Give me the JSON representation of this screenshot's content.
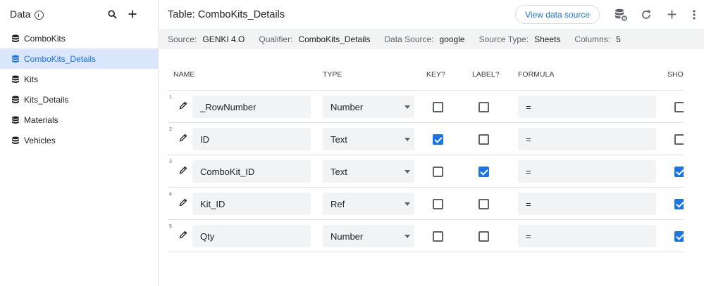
{
  "sidebar": {
    "title": "Data",
    "items": [
      {
        "label": "ComboKits",
        "active": false
      },
      {
        "label": "ComboKits_Details",
        "active": true
      },
      {
        "label": "Kits",
        "active": false
      },
      {
        "label": "Kits_Details",
        "active": false
      },
      {
        "label": "Materials",
        "active": false
      },
      {
        "label": "Vehicles",
        "active": false
      }
    ]
  },
  "header": {
    "title": "Table: ComboKits_Details",
    "view_data_source": "View data source"
  },
  "info": {
    "source_label": "Source:",
    "source_value": "GENKI 4.O",
    "qualifier_label": "Qualifier:",
    "qualifier_value": "ComboKits_Details",
    "datasource_label": "Data Source:",
    "datasource_value": "google",
    "sourcetype_label": "Source Type:",
    "sourcetype_value": "Sheets",
    "columns_label": "Columns:",
    "columns_value": "5"
  },
  "table": {
    "headers": {
      "name": "NAME",
      "type": "TYPE",
      "key": "KEY?",
      "label": "LABEL?",
      "formula": "FORMULA",
      "show": "SHO"
    },
    "rows": [
      {
        "num": "1",
        "name": "_RowNumber",
        "type": "Number",
        "key": false,
        "label": false,
        "formula": "=",
        "show": false
      },
      {
        "num": "2",
        "name": "ID",
        "type": "Text",
        "key": true,
        "label": false,
        "formula": "=",
        "show": false
      },
      {
        "num": "3",
        "name": "ComboKit_ID",
        "type": "Text",
        "key": false,
        "label": true,
        "formula": "=",
        "show": true
      },
      {
        "num": "4",
        "name": "Kit_ID",
        "type": "Ref",
        "key": false,
        "label": false,
        "formula": "=",
        "show": true
      },
      {
        "num": "5",
        "name": "Qty",
        "type": "Number",
        "key": false,
        "label": false,
        "formula": "=",
        "show": true
      }
    ]
  },
  "colors": {
    "accent": "#1a73e8",
    "active_bg": "#d9e6fb"
  }
}
